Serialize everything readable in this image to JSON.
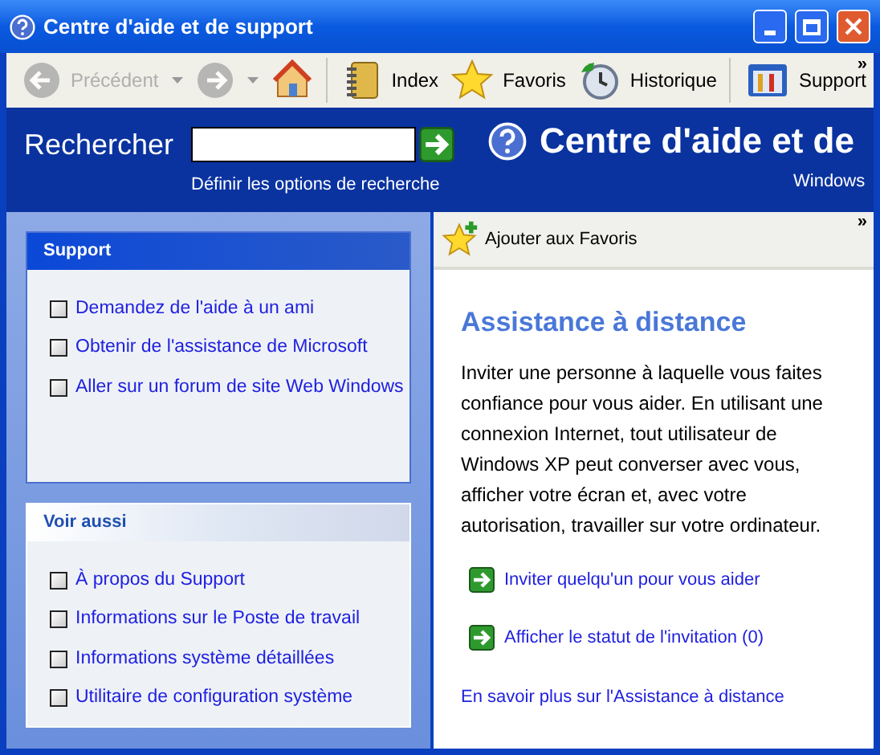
{
  "window": {
    "title": "Centre d'aide et de support"
  },
  "toolbar": {
    "buttons": [
      {
        "kind": "back",
        "label": "Précédent",
        "disabled": true
      },
      {
        "kind": "forward",
        "disabled": true
      },
      {
        "kind": "home",
        "disabled": false
      },
      {
        "kind": "index",
        "label": "Index",
        "disabled": false
      },
      {
        "kind": "favorites",
        "label": "Favoris",
        "disabled": false
      },
      {
        "kind": "history",
        "label": "Historique",
        "disabled": false
      },
      {
        "kind": "support",
        "label": "Support",
        "disabled": false
      }
    ],
    "overflow": "»"
  },
  "search_band": {
    "label": "Rechercher",
    "options_link": "Définir les options de recherche",
    "heading": "Centre d'aide et de",
    "subtitle": "Windows"
  },
  "sidebar": {
    "panels": [
      {
        "kind": "primary",
        "title": "Support",
        "links": [
          "Demandez de l'aide à un ami",
          "Obtenir de l'assistance de Microsoft",
          "Aller sur un forum de site Web Windows"
        ]
      },
      {
        "kind": "secondary",
        "title": "Voir aussi",
        "links": [
          "À propos du Support",
          "Informations sur le Poste de travail",
          "Informations système détaillées",
          "Utilitaire de configuration système"
        ]
      }
    ]
  },
  "content": {
    "action": "Ajouter aux Favoris",
    "overflow": "»",
    "title": "Assistance à distance",
    "paragraph": "Inviter une personne à laquelle vous faites confiance pour vous aider. En utilisant une connexion Internet, tout utilisateur de Windows XP peut converser avec vous, afficher votre écran et, avec votre autorisation, travailler sur votre ordinateur.",
    "tasks": [
      "Inviter quelqu'un pour vous aider",
      "Afficher le statut de l'invitation (0)"
    ],
    "more_link": "En savoir plus sur l'Assistance à distance"
  }
}
